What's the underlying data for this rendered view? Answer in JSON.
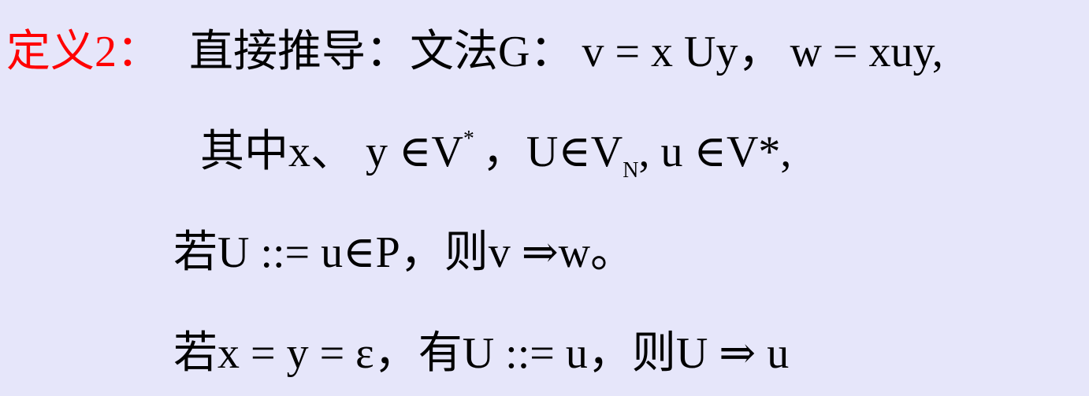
{
  "definition": {
    "label": "定义",
    "number": "2",
    "colon": "：",
    "title": "直接推导：文法",
    "grammar": "G",
    "colon2": "：",
    "v_eq": "v = x Uy",
    "comma1": "，",
    "w_eq": "w = xuy,"
  },
  "line2": {
    "prefix": "其中",
    "xy": "x、 y ∈V",
    "star_sup": "*",
    "comma": "，",
    "U_in": "U∈V",
    "N_sub": "N",
    "comma2": ",",
    "u_in": "u ∈V*,"
  },
  "line3": {
    "if": "若",
    "rule": "U ::= u∈P",
    "comma": "，",
    "then": "则",
    "derive": "v ⇒w",
    "period": "。"
  },
  "line4": {
    "if": "若",
    "eq": "x = y = ε",
    "comma": "，",
    "have": "有",
    "rule": "U ::= u",
    "comma2": "，",
    "then": "则",
    "derive": "U ⇒ u"
  },
  "colors": {
    "background": "#e6e6fa",
    "label": "#ff0000",
    "text": "#000000"
  }
}
